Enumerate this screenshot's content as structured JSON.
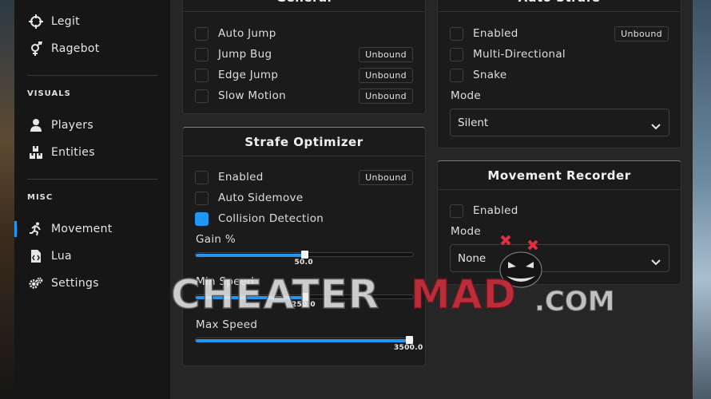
{
  "sidebar": {
    "items_top": [
      {
        "label": "Legit",
        "icon": "crosshair-icon"
      },
      {
        "label": "Ragebot",
        "icon": "gender-icon"
      }
    ],
    "visuals_header": "VISUALS",
    "items_visuals": [
      {
        "label": "Players",
        "icon": "person-icon"
      },
      {
        "label": "Entities",
        "icon": "boxes-icon"
      }
    ],
    "misc_header": "MISC",
    "items_misc": [
      {
        "label": "Movement",
        "icon": "running-icon",
        "active": true
      },
      {
        "label": "Lua",
        "icon": "file-code-icon"
      },
      {
        "label": "Settings",
        "icon": "gears-icon"
      }
    ]
  },
  "general": {
    "title": "General",
    "rows": [
      {
        "label": "Auto Jump",
        "checked": false,
        "key": ""
      },
      {
        "label": "Jump Bug",
        "checked": false,
        "key": "Unbound"
      },
      {
        "label": "Edge Jump",
        "checked": false,
        "key": "Unbound"
      },
      {
        "label": "Slow Motion",
        "checked": false,
        "key": "Unbound"
      }
    ]
  },
  "strafe_optimizer": {
    "title": "Strafe Optimizer",
    "rows": [
      {
        "label": "Enabled",
        "checked": false,
        "key": "Unbound"
      },
      {
        "label": "Auto Sidemove",
        "checked": false,
        "key": ""
      },
      {
        "label": "Collision Detection",
        "checked": true,
        "key": ""
      }
    ],
    "sliders": [
      {
        "label": "Gain %",
        "value_text": "50.0",
        "fraction": 0.5
      },
      {
        "label": "Min Speed",
        "value_text": "250.0",
        "fraction": 0.5
      },
      {
        "label": "Max Speed",
        "value_text": "3500.0",
        "fraction": 1.0
      }
    ]
  },
  "auto_strafe": {
    "title": "Auto Strafe",
    "rows": [
      {
        "label": "Enabled",
        "checked": false,
        "key": "Unbound"
      },
      {
        "label": "Multi-Directional",
        "checked": false,
        "key": ""
      },
      {
        "label": "Snake",
        "checked": false,
        "key": ""
      }
    ],
    "mode_label": "Mode",
    "mode_value": "Silent"
  },
  "movement_recorder": {
    "title": "Movement Recorder",
    "rows": [
      {
        "label": "Enabled",
        "checked": false,
        "key": ""
      }
    ],
    "mode_label": "Mode",
    "mode_value": "None"
  },
  "watermark": {
    "part1": "CHEATER",
    "part2": "MAD",
    "part3": ".COM"
  },
  "colors": {
    "accent": "#2196f3",
    "panel_bg": "#1b1b1b",
    "sidebar_bg": "#161616"
  }
}
